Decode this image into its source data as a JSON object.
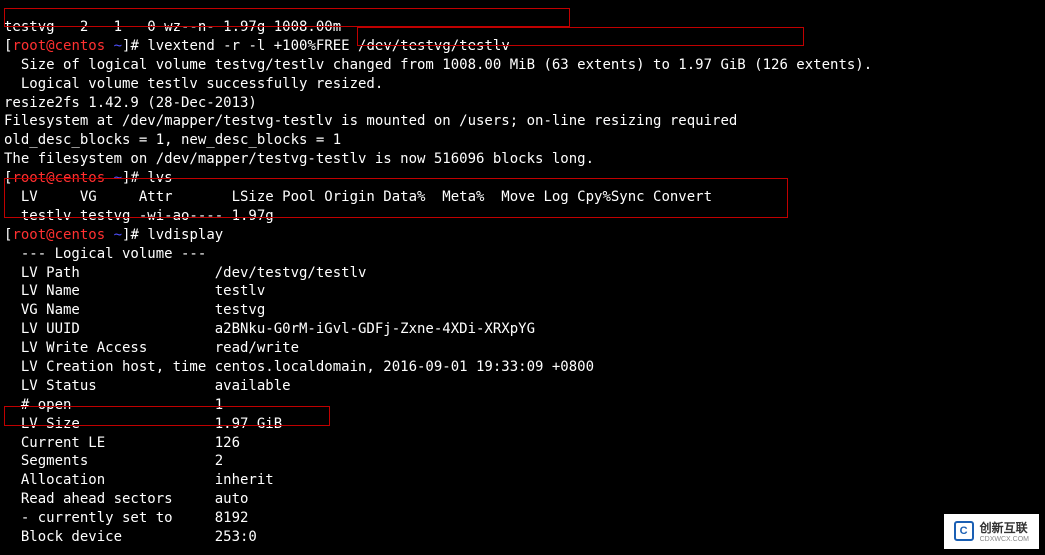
{
  "top_partial": "testvg   2   1   0 wz--n- 1.97g 1008.00m",
  "prompt": {
    "user": "root",
    "host": "centos",
    "path": "~",
    "sep1": "@",
    "close": "]#"
  },
  "cmd1": "lvextend -r -l +100%FREE /dev/testvg/testlv",
  "cmd1_out": [
    "  Size of logical volume testvg/testlv changed from 1008.00 MiB (63 extents) to 1.97 GiB (126 extents).",
    "  Logical volume testlv successfully resized.",
    "resize2fs 1.42.9 (28-Dec-2013)",
    "Filesystem at /dev/mapper/testvg-testlv is mounted on /users; on-line resizing required",
    "old_desc_blocks = 1, new_desc_blocks = 1",
    "The filesystem on /dev/mapper/testvg-testlv is now 516096 blocks long.",
    ""
  ],
  "cmd2": "lvs",
  "cmd2_out": [
    "  LV     VG     Attr       LSize Pool Origin Data%  Meta%  Move Log Cpy%Sync Convert",
    "  testlv testvg -wi-ao---- 1.97g"
  ],
  "cmd3": "lvdisplay",
  "cmd3_out": [
    "  --- Logical volume ---",
    "  LV Path                /dev/testvg/testlv",
    "  LV Name                testlv",
    "  VG Name                testvg",
    "  LV UUID                a2BNku-G0rM-iGvl-GDFj-Zxne-4XDi-XRXpYG",
    "  LV Write Access        read/write",
    "  LV Creation host, time centos.localdomain, 2016-09-01 19:33:09 +0800",
    "  LV Status              available",
    "  # open                 1",
    "  LV Size                1.97 GiB",
    "  Current LE             126",
    "  Segments               2",
    "  Allocation             inherit",
    "  Read ahead sectors     auto",
    "  - currently set to     8192",
    "  Block device           253:0"
  ],
  "watermark": {
    "logo": "C",
    "text": "创新互联",
    "sub": "CDXWCX.COM"
  }
}
